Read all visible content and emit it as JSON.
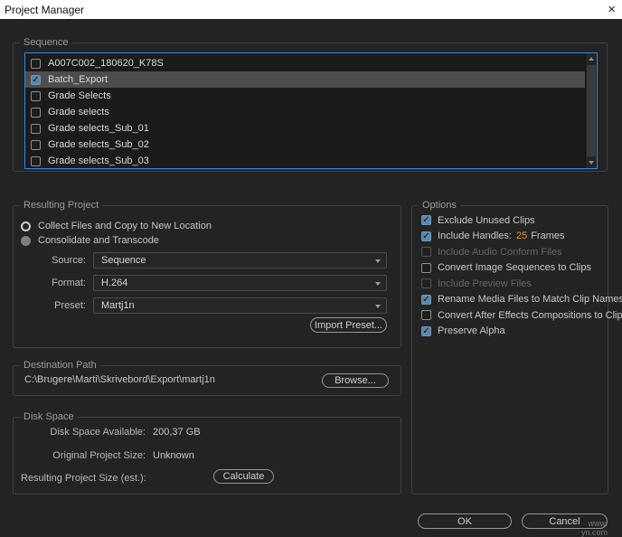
{
  "window": {
    "title": "Project Manager",
    "close_glyph": "×"
  },
  "sequence": {
    "label": "Sequence",
    "items": [
      {
        "name": "A007C002_180620_K78S",
        "checked": false,
        "selected": false
      },
      {
        "name": "Batch_Export",
        "checked": true,
        "selected": true
      },
      {
        "name": "Grade Selects",
        "checked": false,
        "selected": false
      },
      {
        "name": "Grade selects",
        "checked": false,
        "selected": false
      },
      {
        "name": "Grade selects_Sub_01",
        "checked": false,
        "selected": false
      },
      {
        "name": "Grade selects_Sub_02",
        "checked": false,
        "selected": false
      },
      {
        "name": "Grade selects_Sub_03",
        "checked": false,
        "selected": false
      }
    ]
  },
  "resulting_project": {
    "label": "Resulting Project",
    "radios": [
      {
        "label": "Collect Files and Copy to New Location",
        "selected": true
      },
      {
        "label": "Consolidate and Transcode",
        "selected": false
      }
    ],
    "fields": [
      {
        "label": "Source:",
        "value": "Sequence"
      },
      {
        "label": "Format:",
        "value": "H.264"
      },
      {
        "label": "Preset:",
        "value": "Martj1n"
      }
    ],
    "import_preset_button": "Import Preset..."
  },
  "options": {
    "label": "Options",
    "items": [
      {
        "label": "Exclude Unused Clips",
        "checked": true,
        "disabled": false
      },
      {
        "label": "Include Handles:",
        "value": "25",
        "suffix": "Frames",
        "checked": true,
        "disabled": false
      },
      {
        "label": "Include Audio Conform Files",
        "checked": false,
        "disabled": true
      },
      {
        "label": "Convert Image Sequences to Clips",
        "checked": false,
        "disabled": false
      },
      {
        "label": "Include Preview Files",
        "checked": false,
        "disabled": true
      },
      {
        "label": "Rename Media Files to Match Clip Names",
        "checked": true,
        "disabled": false
      },
      {
        "label": "Convert After Effects Compositions to Clips",
        "checked": false,
        "disabled": false
      },
      {
        "label": "Preserve Alpha",
        "checked": true,
        "disabled": false
      }
    ]
  },
  "destination_path": {
    "label": "Destination Path",
    "path": "C:\\Brugere\\Marti\\Skrivebord\\Export\\martj1n",
    "browse_button": "Browse..."
  },
  "disk_space": {
    "label": "Disk Space",
    "rows": [
      {
        "label": "Disk Space Available:",
        "value": "200,37 GB"
      },
      {
        "label": "Original Project Size:",
        "value": "Unknown"
      },
      {
        "label": "Resulting Project Size (est.):",
        "value": ""
      }
    ],
    "calculate_button": "Calculate"
  },
  "footer": {
    "ok_button": "OK",
    "cancel_button": "Cancel"
  },
  "watermark": {
    "line1": "www.",
    "line2": "yn.com"
  },
  "colors": {
    "accent_blue": "#2d8ceb",
    "hot_text_orange": "#e39440",
    "selection_gray": "#4d4d4d",
    "dialog_bg": "#232323"
  }
}
